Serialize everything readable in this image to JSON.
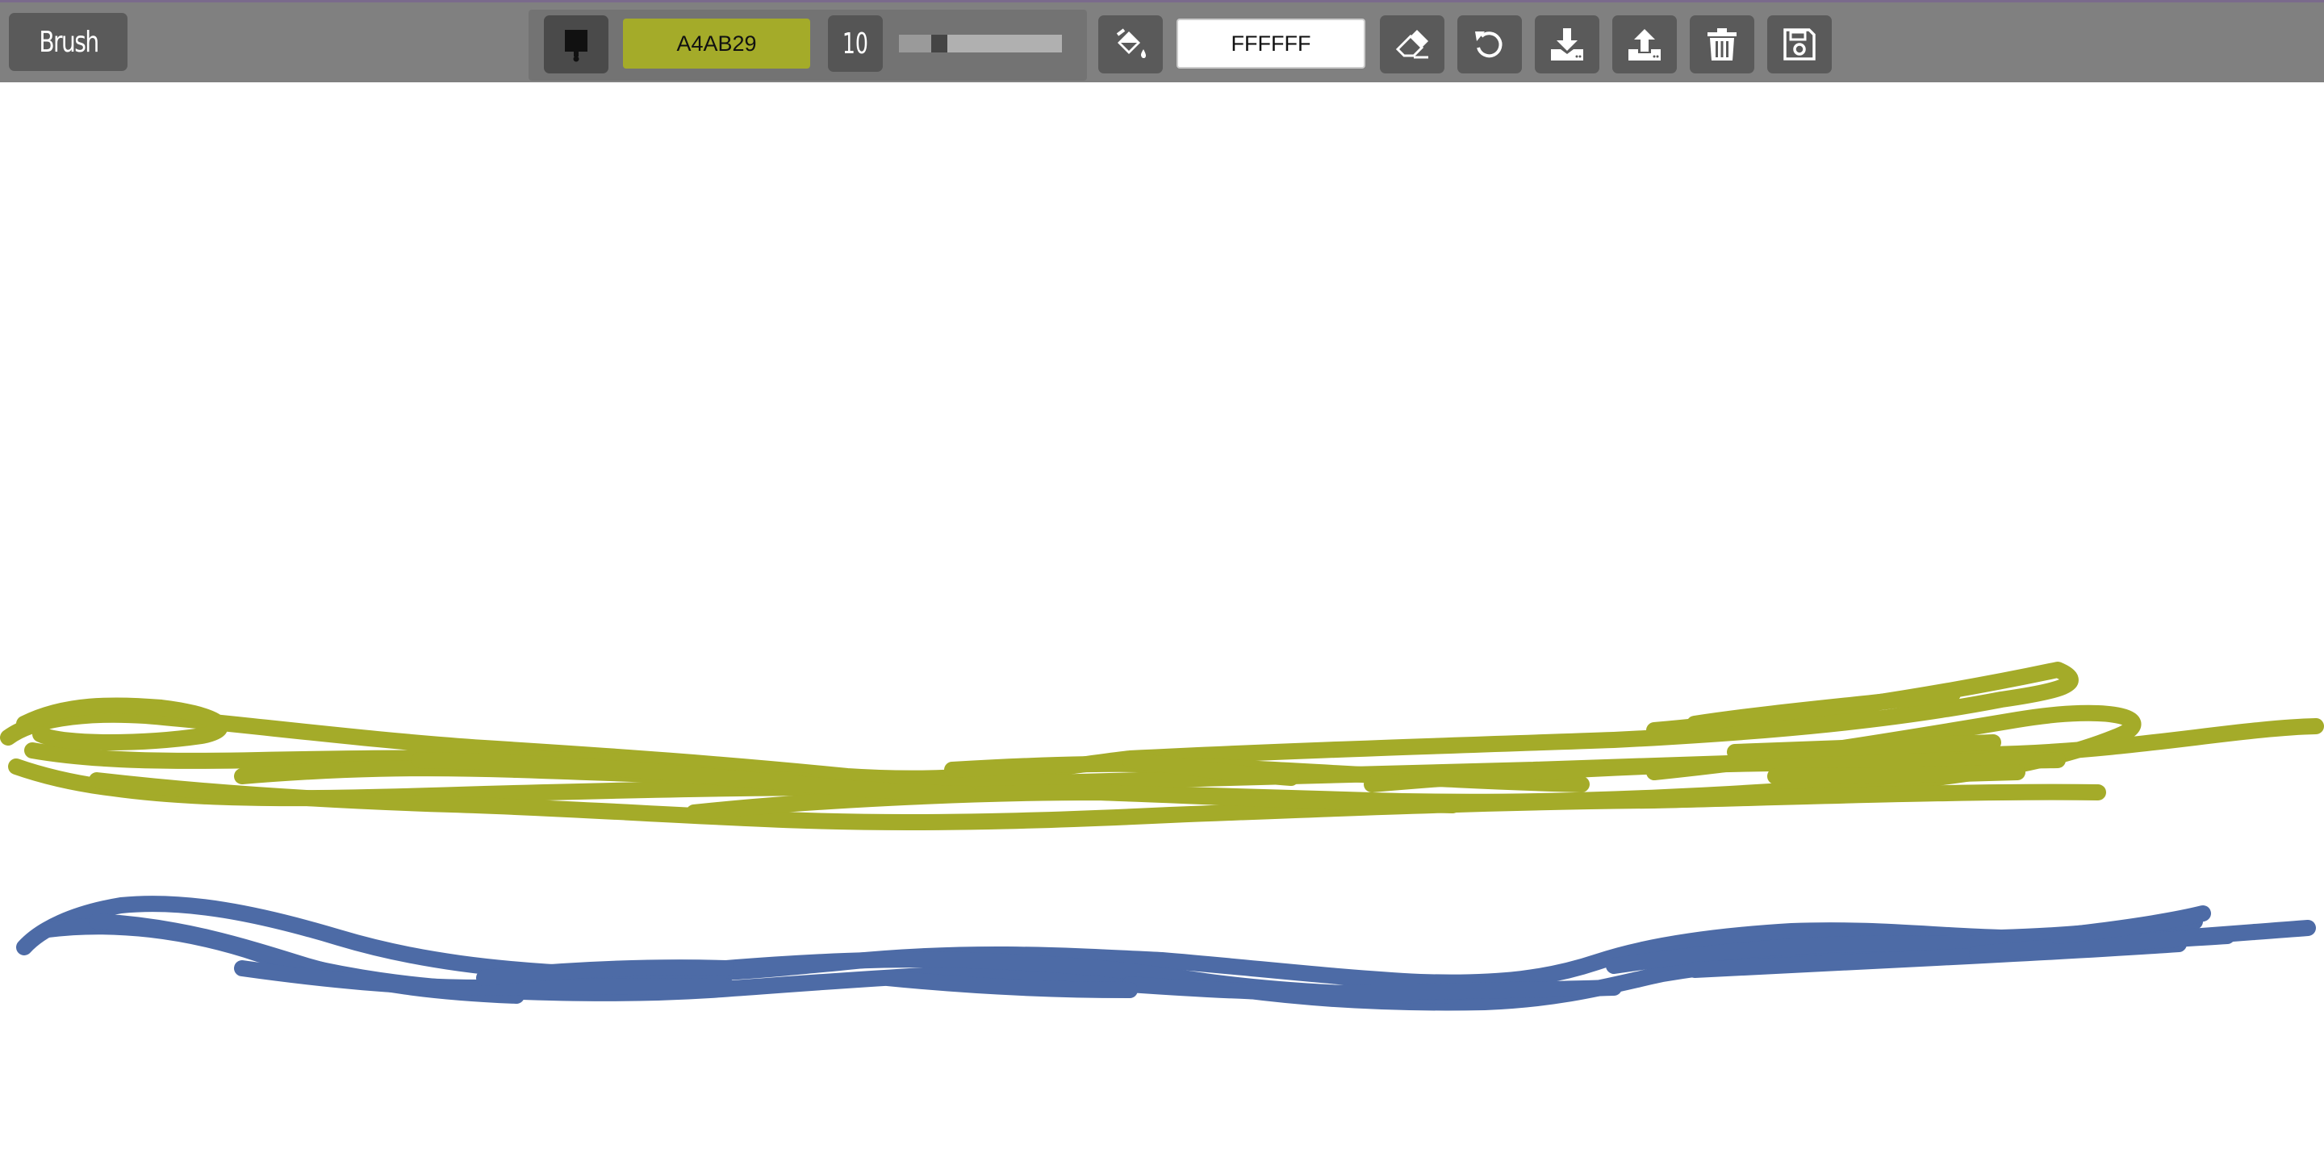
{
  "toolbar": {
    "mode_label": "Brush",
    "brush_color_value": "A4AB29",
    "brush_size_value": "10",
    "brush_size_level": 0.2,
    "background_color_value": "FFFFFF"
  },
  "colors": {
    "brush": "#A4AB29",
    "background": "#FFFFFF",
    "blue_stroke": "#4D6BA6",
    "toolbar_bg": "#808080",
    "button_bg": "#5A5A5A"
  },
  "icons": {
    "brush_tool": "paintbrush-icon",
    "fill_tool": "paint-bucket-icon",
    "eraser": "eraser-icon",
    "undo": "undo-icon",
    "download": "download-icon",
    "upload": "upload-icon",
    "trash": "trash-icon",
    "save": "save-icon"
  }
}
